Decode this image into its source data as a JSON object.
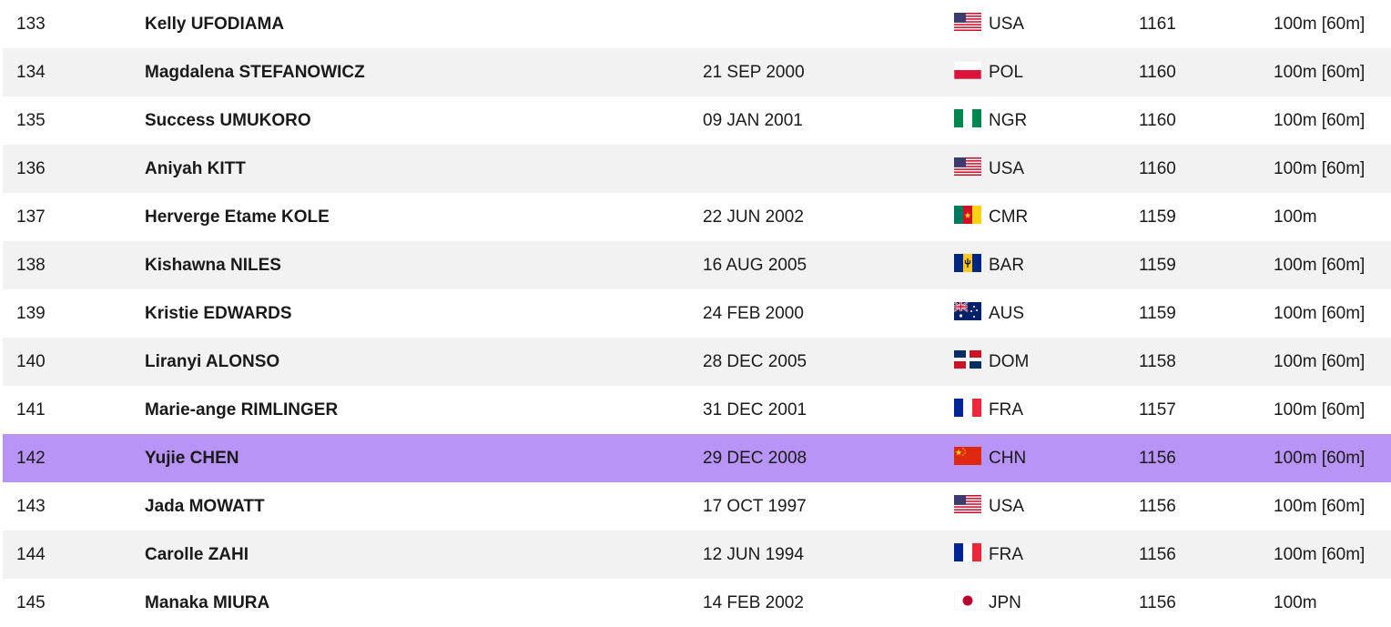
{
  "rows": [
    {
      "place": "133",
      "name": "Kelly UFODIAMA",
      "dob": "",
      "flag": "usa-flag-icon",
      "nat": "USA",
      "score": "1161",
      "event": "100m [60m]"
    },
    {
      "place": "134",
      "name": "Magdalena STEFANOWICZ",
      "dob": "21 SEP 2000",
      "flag": "pol-flag-icon",
      "nat": "POL",
      "score": "1160",
      "event": "100m [60m]"
    },
    {
      "place": "135",
      "name": "Success UMUKORO",
      "dob": "09 JAN 2001",
      "flag": "ngr-flag-icon",
      "nat": "NGR",
      "score": "1160",
      "event": "100m [60m]"
    },
    {
      "place": "136",
      "name": "Aniyah KITT",
      "dob": "",
      "flag": "usa-flag-icon",
      "nat": "USA",
      "score": "1160",
      "event": "100m [60m]"
    },
    {
      "place": "137",
      "name": "Herverge Etame KOLE",
      "dob": "22 JUN 2002",
      "flag": "cmr-flag-icon",
      "nat": "CMR",
      "score": "1159",
      "event": "100m"
    },
    {
      "place": "138",
      "name": "Kishawna NILES",
      "dob": "16 AUG 2005",
      "flag": "bar-flag-icon",
      "nat": "BAR",
      "score": "1159",
      "event": "100m [60m]"
    },
    {
      "place": "139",
      "name": "Kristie EDWARDS",
      "dob": "24 FEB 2000",
      "flag": "aus-flag-icon",
      "nat": "AUS",
      "score": "1159",
      "event": "100m [60m]"
    },
    {
      "place": "140",
      "name": "Liranyi ALONSO",
      "dob": "28 DEC 2005",
      "flag": "dom-flag-icon",
      "nat": "DOM",
      "score": "1158",
      "event": "100m [60m]"
    },
    {
      "place": "141",
      "name": "Marie-ange RIMLINGER",
      "dob": "31 DEC 2001",
      "flag": "fra-flag-icon",
      "nat": "FRA",
      "score": "1157",
      "event": "100m [60m]"
    },
    {
      "place": "142",
      "name": "Yujie CHEN",
      "dob": "29 DEC 2008",
      "flag": "chn-flag-icon",
      "nat": "CHN",
      "score": "1156",
      "event": "100m [60m]",
      "highlight": true
    },
    {
      "place": "143",
      "name": "Jada MOWATT",
      "dob": "17 OCT 1997",
      "flag": "usa-flag-icon",
      "nat": "USA",
      "score": "1156",
      "event": "100m [60m]"
    },
    {
      "place": "144",
      "name": "Carolle ZAHI",
      "dob": "12 JUN 1994",
      "flag": "fra-flag-icon",
      "nat": "FRA",
      "score": "1156",
      "event": "100m [60m]"
    },
    {
      "place": "145",
      "name": "Manaka MIURA",
      "dob": "14 FEB 2002",
      "flag": "jpn-flag-icon",
      "nat": "JPN",
      "score": "1156",
      "event": "100m"
    }
  ],
  "colors": {
    "highlight_row": "#b794f6",
    "stripe_row": "#f2f2f2",
    "text": "#1a1a1a"
  }
}
